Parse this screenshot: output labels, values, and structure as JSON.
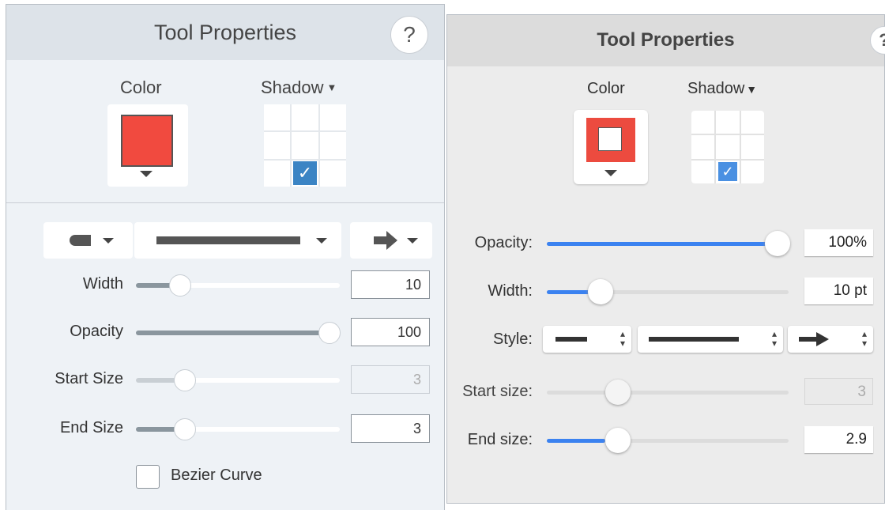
{
  "left_panel": {
    "title": "Tool Properties",
    "help": "?",
    "color_label": "Color",
    "shadow_label": "Shadow",
    "color_swatch": "#f14a3f",
    "shadow_checkmark": "✓",
    "width": {
      "label": "Width",
      "value": "10",
      "level": 0.2
    },
    "opacity": {
      "label": "Opacity",
      "value": "100",
      "level": 0.95
    },
    "start_size": {
      "label": "Start Size",
      "value": "3",
      "level": 0.24
    },
    "end_size": {
      "label": "End Size",
      "value": "3",
      "level": 0.24
    },
    "bezier_label": "Bezier Curve",
    "bezier_checked": false
  },
  "right_panel": {
    "title": "Tool Properties",
    "help": "?",
    "color_label": "Color",
    "shadow_label": "Shadow",
    "color_swatch": "#ec4b3f",
    "shadow_checkmark": "✓",
    "opacity": {
      "label": "Opacity:",
      "value": "100%",
      "level": 0.95
    },
    "width": {
      "label": "Width:",
      "value": "10 pt",
      "level": 0.2
    },
    "style_label": "Style:",
    "start_size": {
      "label": "Start size:",
      "value": "3",
      "level": 0.24
    },
    "end_size": {
      "label": "End size:",
      "value": "2.9",
      "level": 0.24
    }
  },
  "colors": {
    "accent_blue": "#3b82f0",
    "checkbox_blue": "#3b84c4",
    "swatch_red": "#f14a3f"
  }
}
